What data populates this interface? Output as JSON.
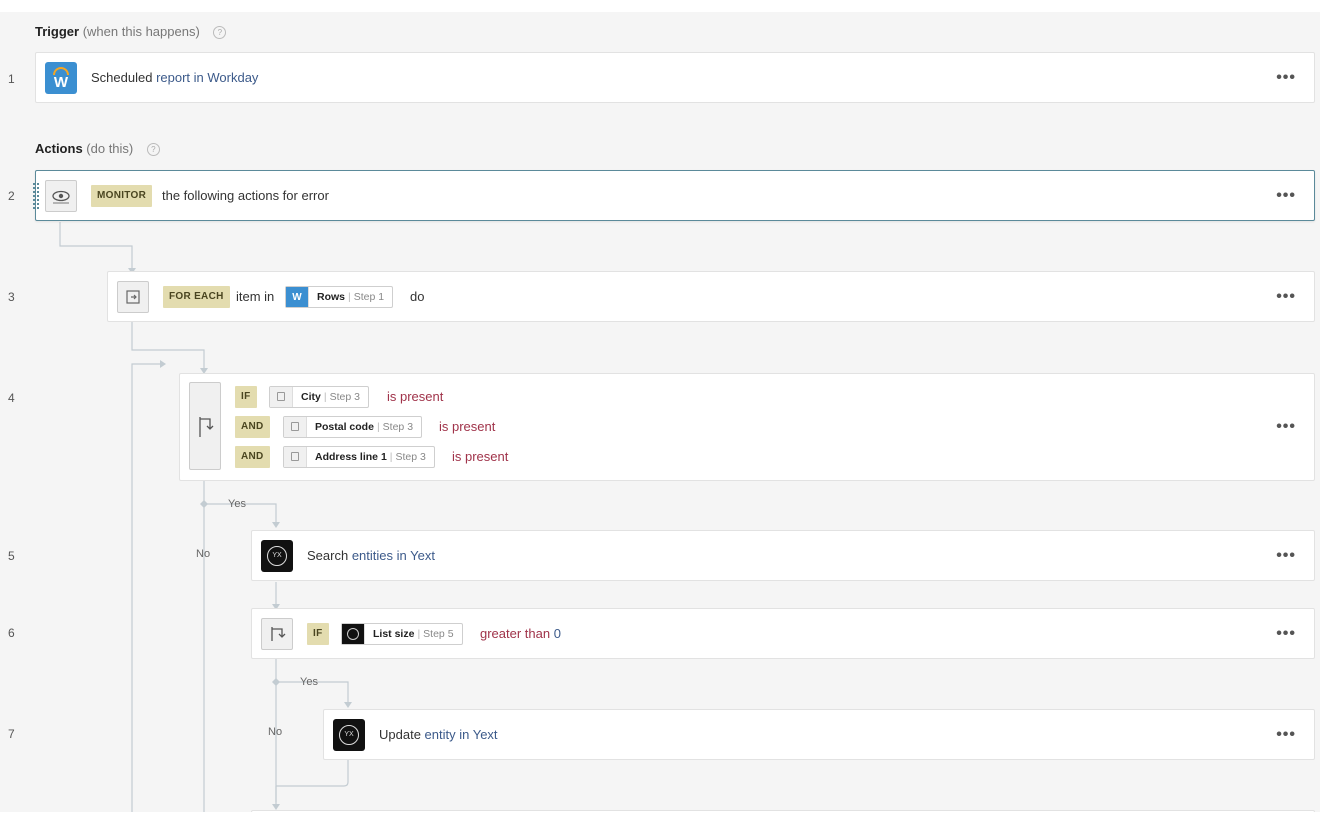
{
  "trigger_section": {
    "title": "Trigger",
    "subtitle": "(when this happens)"
  },
  "actions_section": {
    "title": "Actions",
    "subtitle": "(do this)"
  },
  "steps": [
    {
      "num": "1",
      "pre": "Scheduled",
      "link": "report in Workday"
    },
    {
      "num": "2",
      "keyword": "MONITOR",
      "text": "the following actions for error"
    },
    {
      "num": "3",
      "keyword": "FOR EACH",
      "pre": "item in",
      "pill": {
        "name": "Rows",
        "step": "Step 1"
      },
      "post": "do"
    },
    {
      "num": "4",
      "conditions": [
        {
          "keyword": "IF",
          "pill": {
            "name": "City",
            "step": "Step 3"
          },
          "op": "is present"
        },
        {
          "keyword": "AND",
          "pill": {
            "name": "Postal code",
            "step": "Step 3"
          },
          "op": "is present"
        },
        {
          "keyword": "AND",
          "pill": {
            "name": "Address line 1",
            "step": "Step 3"
          },
          "op": "is present"
        }
      ]
    },
    {
      "num": "5",
      "pre": "Search",
      "link": "entities in Yext"
    },
    {
      "num": "6",
      "keyword": "IF",
      "pill": {
        "name": "List size",
        "step": "Step 5"
      },
      "op": "greater than",
      "value": "0"
    },
    {
      "num": "7",
      "pre": "Update",
      "link": "entity in Yext"
    }
  ],
  "branch_labels": {
    "yes": "Yes",
    "no": "No"
  },
  "more_label": "•••",
  "help_glyph": "?",
  "colors": {
    "keyword_bg": "#e3dcaf",
    "workday_blue": "#3b8fd1",
    "workday_orange": "#f5a623",
    "condition_red": "#a0334a",
    "link_blue": "#3c5a8a"
  }
}
